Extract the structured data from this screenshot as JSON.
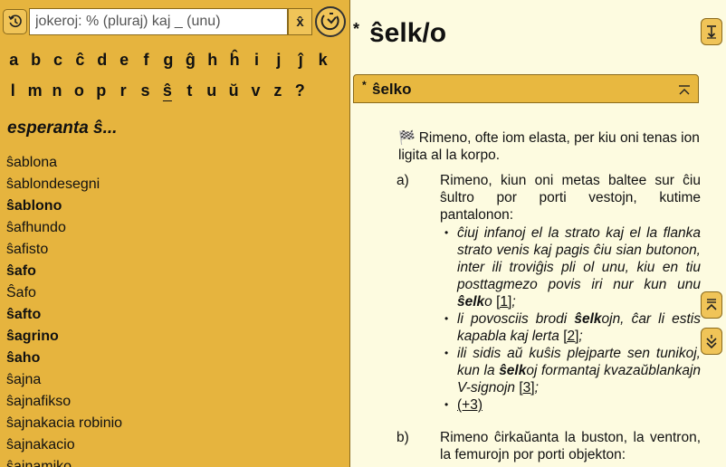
{
  "search": {
    "placeholder": "jokeroj: % (pluraj) kaj _ (unu)",
    "value": "",
    "xsys_label": "x̂"
  },
  "alphabet": {
    "row1": [
      "a",
      "b",
      "c",
      "ĉ",
      "d",
      "e",
      "f",
      "g",
      "ĝ",
      "h",
      "ĥ",
      "i",
      "j",
      "ĵ",
      "k"
    ],
    "row2": [
      "l",
      "m",
      "n",
      "o",
      "p",
      "r",
      "s",
      "ŝ",
      "t",
      "u",
      "ŭ",
      "v",
      "z",
      "?"
    ],
    "current": "ŝ"
  },
  "list": {
    "heading": "esperanta ŝ...",
    "items": [
      {
        "text": "ŝablona",
        "bold": false
      },
      {
        "text": "ŝablondesegni",
        "bold": false
      },
      {
        "text": "ŝablono",
        "bold": true
      },
      {
        "text": "ŝafhundo",
        "bold": false
      },
      {
        "text": "ŝafisto",
        "bold": false
      },
      {
        "text": "ŝafo",
        "bold": true
      },
      {
        "text": "Ŝafo",
        "bold": false
      },
      {
        "text": "ŝafto",
        "bold": true
      },
      {
        "text": "ŝagrino",
        "bold": true
      },
      {
        "text": "ŝaho",
        "bold": true
      },
      {
        "text": "ŝajna",
        "bold": false
      },
      {
        "text": "ŝajnafikso",
        "bold": false
      },
      {
        "text": "ŝajnakacia robinio",
        "bold": false
      },
      {
        "text": "ŝajnakacio",
        "bold": false
      },
      {
        "text": "ŝajnamiko",
        "bold": false
      }
    ]
  },
  "article": {
    "star": "*",
    "title": "ŝelk/o",
    "derivation": {
      "star": "*",
      "title": "ŝelko",
      "fak_icon": "🏁",
      "definition": "Rimeno, ofte iom elasta, per kiu oni tenas ion ligita al la korpo.",
      "senses": [
        {
          "num": "a)",
          "definition": "Rimeno, kiun oni metas baltee sur ĉiu ŝultro por porti vestojn, kutime pantalonon:",
          "examples": [
            {
              "pre": "ĉiuj infanoj el la strato kaj el la flanka strato venis kaj pagis ĉiu sian butonon, inter ili troviĝis pli ol unu, kiu en tiu posttagmezo povis iri nur kun unu ",
              "bold": "ŝelk",
              "post": "o ",
              "ref": "[1]",
              "end": ";"
            },
            {
              "pre": "li povosciis brodi ",
              "bold": "ŝelk",
              "post": "ojn, ĉar li estis kapabla kaj lerta ",
              "ref": "[2]",
              "end": ";"
            },
            {
              "pre": "ili sidis aŭ kuŝis plejparte sen tunikoj, kun la ",
              "bold": "ŝelk",
              "post": "oj formantaj kvazaŭblankajn V-signojn ",
              "ref": "[3]",
              "end": ";"
            }
          ],
          "more": "(+3)"
        },
        {
          "num": "b)",
          "definition": "Rimeno ĉirkaŭanta la buston, la ventron, la femurojn por porti objekton:"
        }
      ]
    }
  },
  "colors": {
    "panel": "#e6b43e",
    "button": "#f0c458",
    "article_bg": "#fdfbe0",
    "border": "#8a6a1c"
  },
  "icons": {
    "history": "history-icon",
    "logo": "revo-logo-icon",
    "top_nav": "arrow-down-bar-icon",
    "collapse": "collapse-up-icon",
    "section_up": "section-up-icon",
    "section_down": "double-chevron-down-icon"
  }
}
